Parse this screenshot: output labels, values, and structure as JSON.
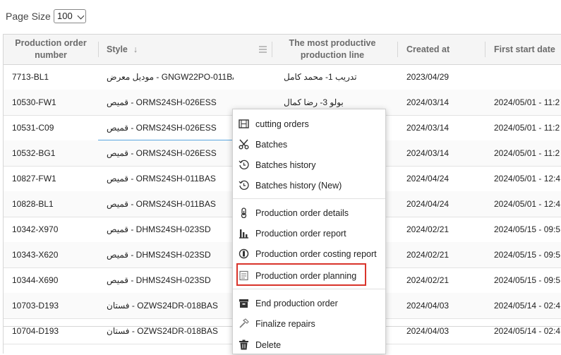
{
  "page_size": {
    "label": "Page Size",
    "value": "100"
  },
  "columns": [
    {
      "label": "Production order number"
    },
    {
      "label": "Style",
      "sort_indicator": "↓"
    },
    {
      "label": "The most productive production line"
    },
    {
      "label": "Created at"
    },
    {
      "label": "First start date"
    }
  ],
  "rows": [
    {
      "order": "7713-BL1",
      "style": "موديل معرض - GNGW22PO-011BA",
      "line": "تدريب 1- محمد كامل",
      "created": "2023/04/29",
      "first_start": ""
    },
    {
      "order": "10530-FW1",
      "style": "قميص - ORMS24SH-026ESS",
      "line": "بولو 3- رضا كمال",
      "created": "2024/03/14",
      "first_start": "2024/05/01 - 11:2"
    },
    {
      "order": "10531-C09",
      "style": "قميص - ORMS24SH-026ESS",
      "line": "",
      "created": "2024/03/14",
      "first_start": "2024/05/01 - 11:2"
    },
    {
      "order": "10532-BG1",
      "style": "قميص - ORMS24SH-026ESS",
      "line": "",
      "created": "2024/03/14",
      "first_start": "2024/05/01 - 11:2"
    },
    {
      "order": "10827-FW1",
      "style": "قميص - ORMS24SH-011BAS",
      "line": "",
      "created": "2024/04/24",
      "first_start": "2024/05/01 - 12:4"
    },
    {
      "order": "10828-BL1",
      "style": "قميص - ORMS24SH-011BAS",
      "line": "",
      "created": "2024/04/24",
      "first_start": "2024/05/01 - 12:4"
    },
    {
      "order": "10342-X970",
      "style": "قميص - DHMS24SH-023SD",
      "line": "",
      "created": "2024/02/21",
      "first_start": "2024/05/15 - 09:5"
    },
    {
      "order": "10343-X620",
      "style": "قميص - DHMS24SH-023SD",
      "line": "",
      "created": "2024/02/21",
      "first_start": "2024/05/15 - 09:5"
    },
    {
      "order": "10344-X690",
      "style": "قميص - DHMS24SH-023SD",
      "line": "",
      "created": "2024/02/21",
      "first_start": "2024/05/15 - 09:5"
    },
    {
      "order": "10703-D193",
      "style": "فستان - OZWS24DR-018BAS",
      "line": "",
      "created": "2024/04/03",
      "first_start": "2024/05/14 - 02:4"
    },
    {
      "order": "10704-D193",
      "style": "فستان - OZWS24DR-018BAS",
      "line": "",
      "created": "2024/04/03",
      "first_start": "2024/05/14 - 02:4"
    }
  ],
  "menu": [
    {
      "label": "cutting orders",
      "icon": "film-icon"
    },
    {
      "label": "Batches",
      "icon": "scissors-icon"
    },
    {
      "label": "Batches history",
      "icon": "history-icon"
    },
    {
      "label": "Batches history (New)",
      "icon": "history-icon"
    },
    {
      "label": "Production order details",
      "icon": "thermometer-icon"
    },
    {
      "label": "Production order report",
      "icon": "bar-chart-icon"
    },
    {
      "label": "Production order costing report",
      "icon": "coin-icon"
    },
    {
      "label": "Production order planning",
      "icon": "planning-icon"
    },
    {
      "label": "End production order",
      "icon": "archive-box-icon"
    },
    {
      "label": "Finalize repairs",
      "icon": "hammer-icon"
    },
    {
      "label": "Delete",
      "icon": "trash-icon"
    }
  ],
  "colors": {
    "highlight_border": "#d9342b",
    "selection_fill": "#cfe7f8",
    "selection_border": "#5aa7e0"
  }
}
